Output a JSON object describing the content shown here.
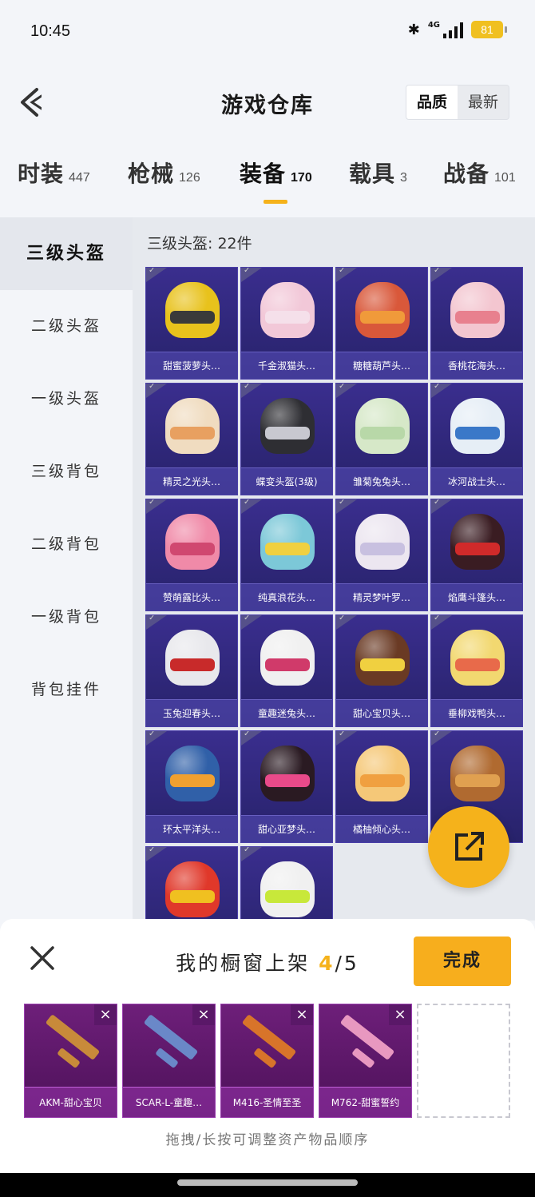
{
  "status": {
    "time": "10:45",
    "network": "4G",
    "battery": "81"
  },
  "header": {
    "title": "游戏仓库",
    "sort": [
      "品质",
      "最新"
    ]
  },
  "categories": [
    {
      "label": "时装",
      "count": "447"
    },
    {
      "label": "枪械",
      "count": "126"
    },
    {
      "label": "装备",
      "count": "170"
    },
    {
      "label": "载具",
      "count": "3"
    },
    {
      "label": "战备",
      "count": "101"
    }
  ],
  "side": [
    "三级头盔",
    "二级头盔",
    "一级头盔",
    "三级背包",
    "二级背包",
    "一级背包",
    "背包挂件"
  ],
  "grid": {
    "subtitle": "三级头盔: 22件",
    "items": [
      {
        "name": "甜蜜菠萝头…",
        "color": "#e8c21c",
        "visor": "#3a3a3a"
      },
      {
        "name": "千金淑猫头…",
        "color": "#f2c8d8",
        "visor": "#f5e0ea"
      },
      {
        "name": "糖糖葫芦头…",
        "color": "#d9583a",
        "visor": "#f09a3a"
      },
      {
        "name": "香桃花海头…",
        "color": "#f3c6d0",
        "visor": "#e8808e"
      },
      {
        "name": "精灵之光头…",
        "color": "#f0dcc0",
        "visor": "#e8a060"
      },
      {
        "name": "蝶变头盔(3级)",
        "color": "#2e2e33",
        "visor": "#c8c8d0"
      },
      {
        "name": "雏菊兔兔头…",
        "color": "#d6e8c8",
        "visor": "#b8d8a8"
      },
      {
        "name": "冰河战士头…",
        "color": "#e6eef6",
        "visor": "#3a78c8"
      },
      {
        "name": "赞萌露比头…",
        "color": "#f08aa8",
        "visor": "#d04870"
      },
      {
        "name": "纯真浪花头…",
        "color": "#7cc8d8",
        "visor": "#f0d040"
      },
      {
        "name": "精灵梦叶罗…",
        "color": "#ece6f0",
        "visor": "#c8c0e0"
      },
      {
        "name": "焰鹰斗篷头…",
        "color": "#3a1c22",
        "visor": "#d02a2a"
      },
      {
        "name": "玉兔迎春头…",
        "color": "#e8e8ec",
        "visor": "#c82a2a"
      },
      {
        "name": "童趣迷兔头…",
        "color": "#f0f0f0",
        "visor": "#d03a6a"
      },
      {
        "name": "甜心宝贝头…",
        "color": "#6a3a24",
        "visor": "#f0d040"
      },
      {
        "name": "垂柳戏鸭头…",
        "color": "#f2d870",
        "visor": "#e86a4a"
      },
      {
        "name": "环太平洋头…",
        "color": "#3060a8",
        "visor": "#f0a030"
      },
      {
        "name": "甜心亚梦头…",
        "color": "#2a1a22",
        "visor": "#e84a8a"
      },
      {
        "name": "橘柚倾心头…",
        "color": "#f5c878",
        "visor": "#f0a040"
      },
      {
        "name": "",
        "color": "#b06a30",
        "visor": "#e0a050"
      },
      {
        "name": "",
        "color": "#e0382a",
        "visor": "#f0c020"
      },
      {
        "name": "",
        "color": "#f0f0f0",
        "visor": "#c8e83a"
      }
    ]
  },
  "sheet": {
    "title_prefix": "我的橱窗上架 ",
    "current": "4",
    "total": "/5",
    "done": "完成",
    "slots": [
      {
        "name": "AKM-甜心宝贝",
        "color": "#c88a3a"
      },
      {
        "name": "SCAR-L-童趣…",
        "color": "#6a88c8"
      },
      {
        "name": "M416-圣情至圣",
        "color": "#d8742a"
      },
      {
        "name": "M762-甜蜜誓约",
        "color": "#e898c0"
      }
    ],
    "hint": "拖拽/长按可调整资产物品顺序"
  }
}
